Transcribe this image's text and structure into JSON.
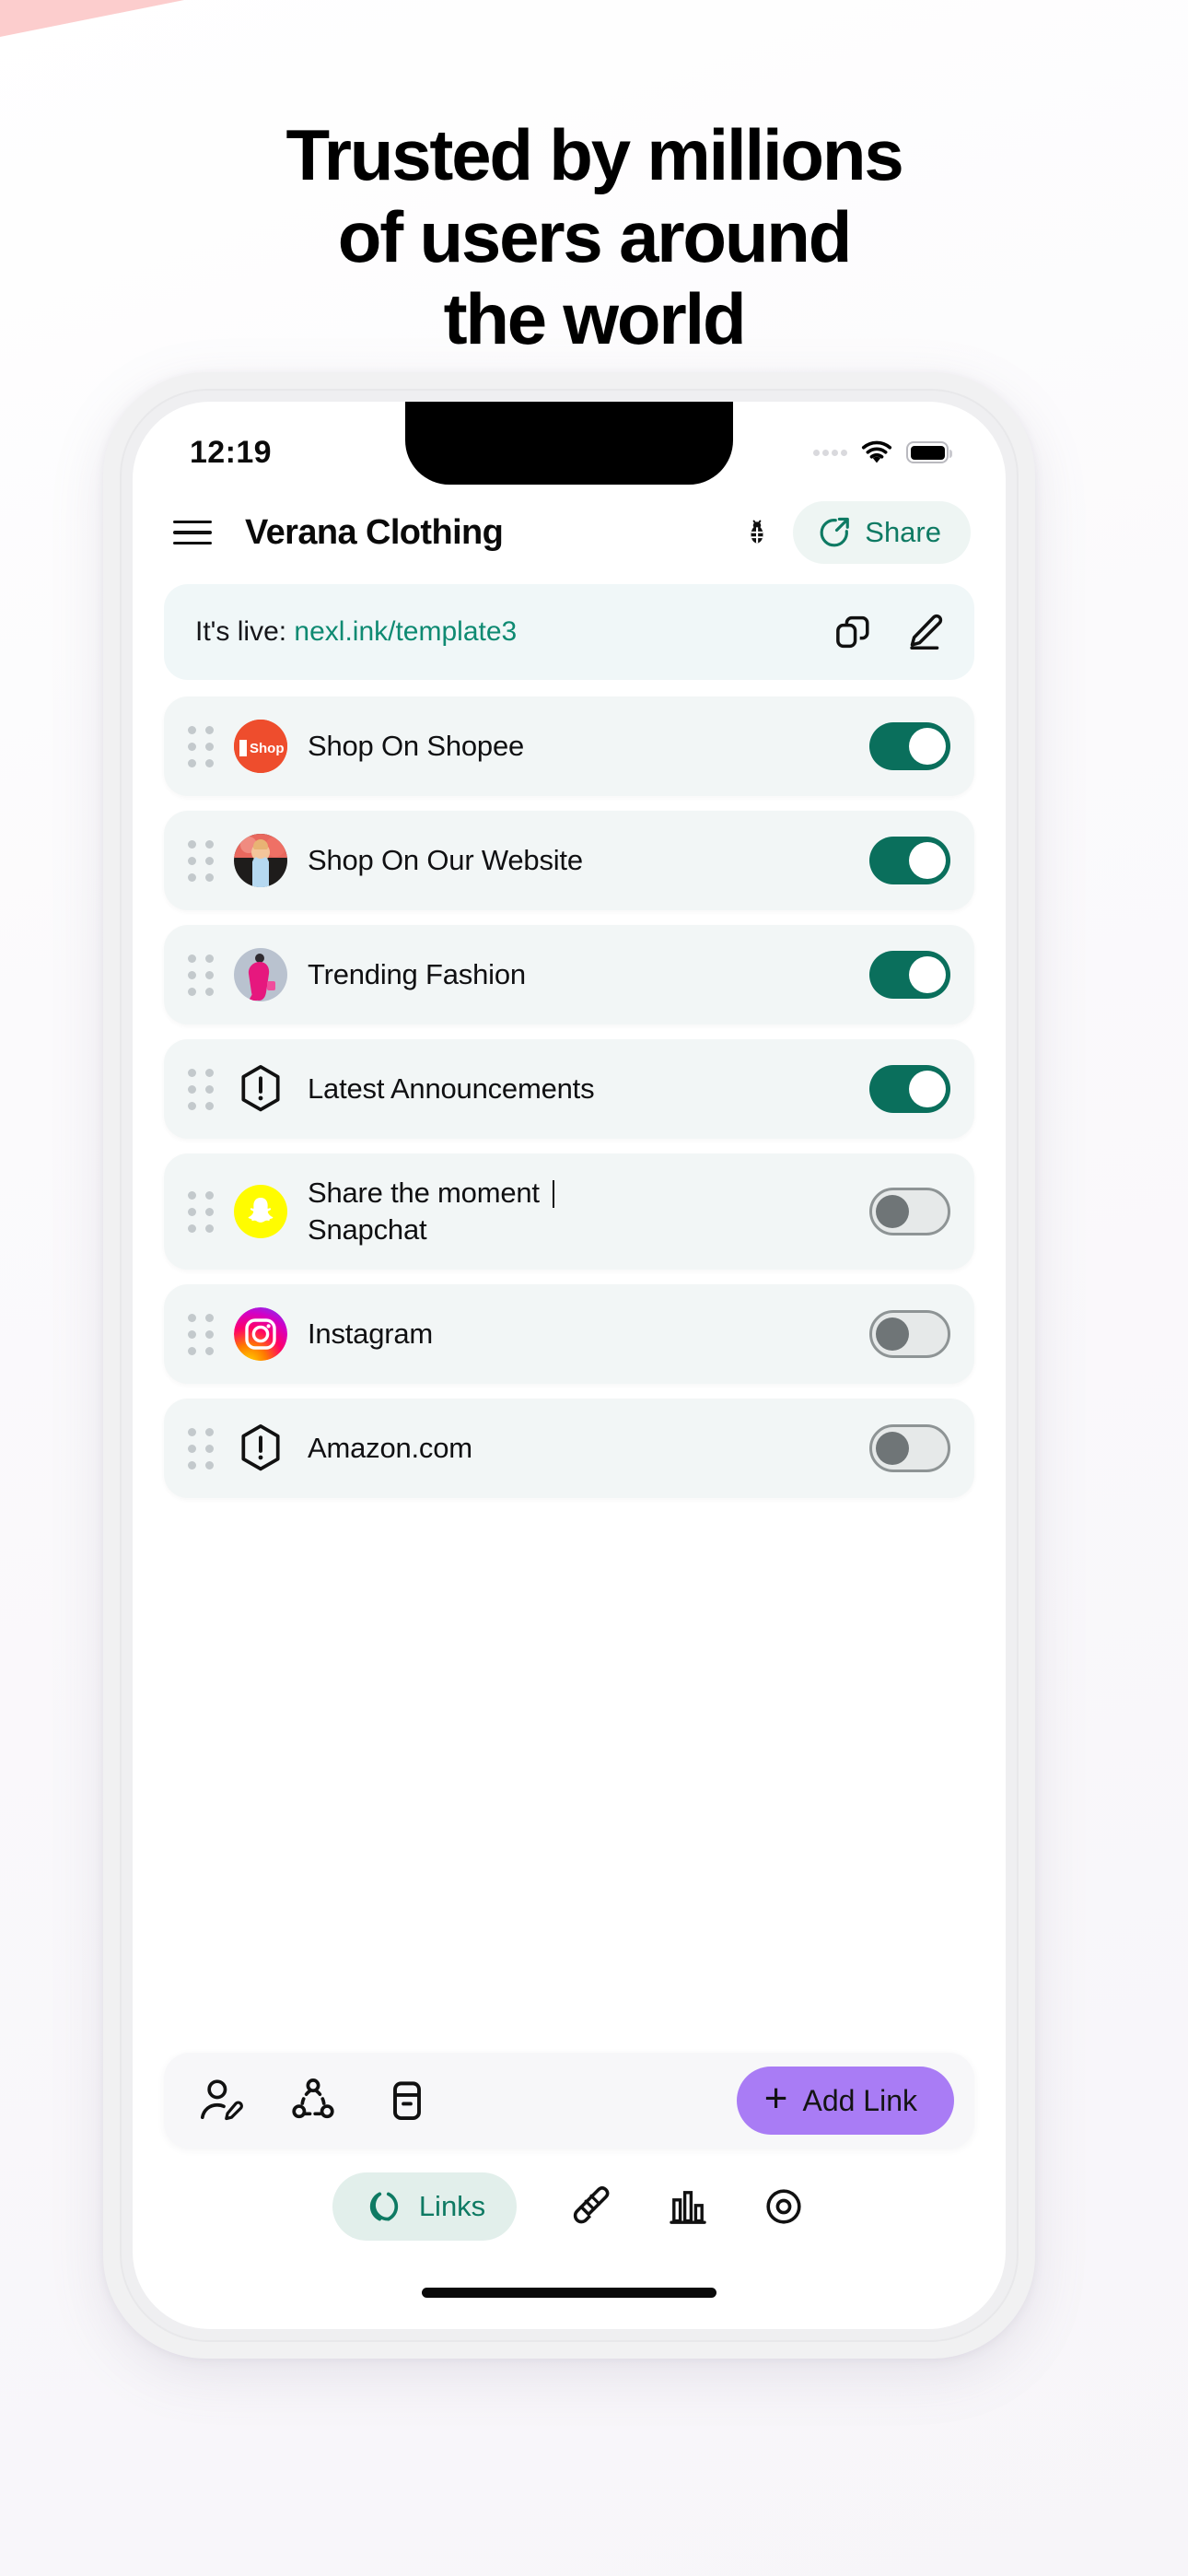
{
  "headline": {
    "line1": "Trusted by millions",
    "line2": "of users around",
    "line3": "the world"
  },
  "status_bar": {
    "time": "12:19",
    "wifi_icon": "wifi-icon",
    "battery_icon": "battery-icon",
    "signal_icon": "signal-dots-icon"
  },
  "app_header": {
    "menu_icon": "hamburger-menu-icon",
    "title": "Verana Clothing",
    "bug_icon": "bug-icon",
    "share_label": "Share",
    "share_icon": "share-arrow-icon"
  },
  "live_bar": {
    "prefix": "It's live: ",
    "url": "nexl.ink/template3",
    "copy_icon": "copy-icon",
    "edit_icon": "pencil-edit-icon"
  },
  "links": [
    {
      "label": "Shop On Shopee",
      "icon": "shopee-logo",
      "enabled": true,
      "toggle_state": "on"
    },
    {
      "label": "Shop On Our Website",
      "icon": "website-photo",
      "enabled": true,
      "toggle_state": "on"
    },
    {
      "label": "Trending Fashion",
      "icon": "fashion-photo",
      "enabled": true,
      "toggle_state": "on"
    },
    {
      "label": "Latest Announcements",
      "icon": "alert-hexagon-icon",
      "enabled": true,
      "toggle_state": "on"
    },
    {
      "label": "Share the moment ",
      "label2": "Snapchat",
      "icon": "snapchat-logo",
      "enabled": false,
      "toggle_state": "off",
      "has_caret": true
    },
    {
      "label": "Instagram",
      "icon": "instagram-logo",
      "enabled": false,
      "toggle_state": "off"
    },
    {
      "label": "Amazon.com",
      "icon": "alert-hexagon-icon",
      "enabled": false,
      "toggle_state": "off"
    }
  ],
  "toolbar": {
    "profile_icon": "edit-profile-icon",
    "network_icon": "share-network-icon",
    "archive_icon": "archive-icon",
    "add_link_label": "Add Link",
    "add_link_plus": "+"
  },
  "bottom_nav": {
    "links_label": "Links",
    "links_icon": "links-chain-icon",
    "design_icon": "design-brush-icon",
    "analytics_icon": "bar-chart-icon",
    "preview_icon": "eye-preview-icon"
  },
  "colors": {
    "accent_green": "#0e7a63",
    "toggle_on": "#0a6f5c",
    "add_link_purple": "#a97cf5",
    "pink_corner": "#fccdcd",
    "row_bg": "#f2f6f6"
  }
}
